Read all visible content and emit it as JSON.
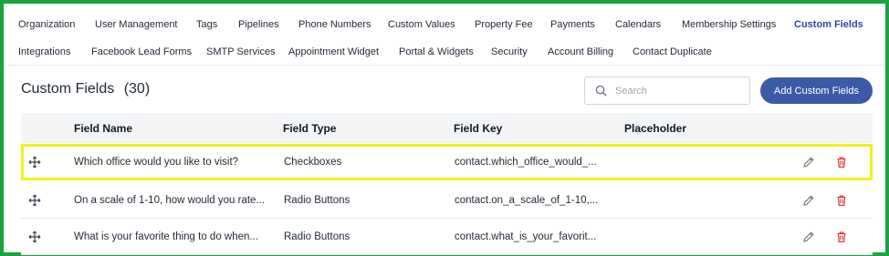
{
  "nav": {
    "row1": [
      {
        "label": "Organization"
      },
      {
        "label": "User Management"
      },
      {
        "label": "Tags"
      },
      {
        "label": "Pipelines"
      },
      {
        "label": "Phone Numbers"
      },
      {
        "label": "Custom Values"
      },
      {
        "label": "Property Fee"
      },
      {
        "label": "Payments"
      },
      {
        "label": "Calendars"
      },
      {
        "label": "Membership Settings"
      },
      {
        "label": "Custom Fields",
        "active": true
      }
    ],
    "row2": [
      {
        "label": "Integrations"
      },
      {
        "label": "Facebook Lead Forms"
      },
      {
        "label": "SMTP Services"
      },
      {
        "label": "Appointment Widget"
      },
      {
        "label": "Portal & Widgets"
      },
      {
        "label": "Security"
      },
      {
        "label": "Account Billing"
      },
      {
        "label": "Contact Duplicate"
      }
    ]
  },
  "header": {
    "title": "Custom Fields",
    "count": "(30)",
    "search_placeholder": "Search",
    "add_button": "Add Custom Fields"
  },
  "table": {
    "columns": [
      "Field Name",
      "Field Type",
      "Field Key",
      "Placeholder"
    ],
    "rows": [
      {
        "name": "Which office would you like to visit?",
        "type": "Checkboxes",
        "key": "contact.which_office_would_...",
        "placeholder": "",
        "highlighted": true
      },
      {
        "name": "On a scale of 1-10, how would you rate...",
        "type": "Radio Buttons",
        "key": "contact.on_a_scale_of_1-10,...",
        "placeholder": "",
        "highlighted": false
      },
      {
        "name": "What is your favorite thing to do when...",
        "type": "Radio Buttons",
        "key": "contact.what_is_your_favorit...",
        "placeholder": "",
        "highlighted": false
      }
    ]
  },
  "colors": {
    "frame_border": "#1aa33f",
    "highlight_border": "#f2f21a",
    "primary": "#3b5ba9",
    "active_tab": "#2b4a9a",
    "delete_icon": "#dc2626"
  },
  "icons": {
    "search": "search-icon",
    "drag": "drag-move-icon",
    "edit": "pencil-icon",
    "delete": "trash-icon"
  }
}
